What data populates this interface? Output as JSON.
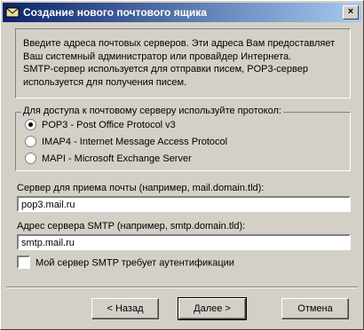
{
  "window": {
    "title": "Создание нового почтового ящика",
    "close_glyph": "×"
  },
  "info": {
    "line1": "Введите адреса почтовых серверов. Эти адреса Вам предоставляет",
    "line2": "Ваш системный администратор или провайдер Интернета.",
    "line3": "SMTP-сервер используется для отправки писем, POP3-сервер",
    "line4": "используется для получения писем."
  },
  "protocol": {
    "legend": "Для доступа к почтовому серверу используйте протокол:",
    "options": [
      {
        "label": "POP3  -  Post Office Protocol v3",
        "selected": true
      },
      {
        "label": "IMAP4 - Internet Message Access Protocol",
        "selected": false
      },
      {
        "label": "MAPI - Microsoft Exchange Server",
        "selected": false
      }
    ]
  },
  "incoming": {
    "label": "Сервер для приема почты  (например, mail.domain.tld):",
    "value": "pop3.mail.ru"
  },
  "smtp": {
    "label": "Адрес сервера SMTP (например, smtp.domain.tld):",
    "value": "smtp.mail.ru"
  },
  "auth": {
    "label": "Мой сервер SMTP требует аутентификации",
    "checked": false
  },
  "buttons": {
    "back": "< Назад",
    "next": "Далее >",
    "cancel": "Отмена"
  }
}
